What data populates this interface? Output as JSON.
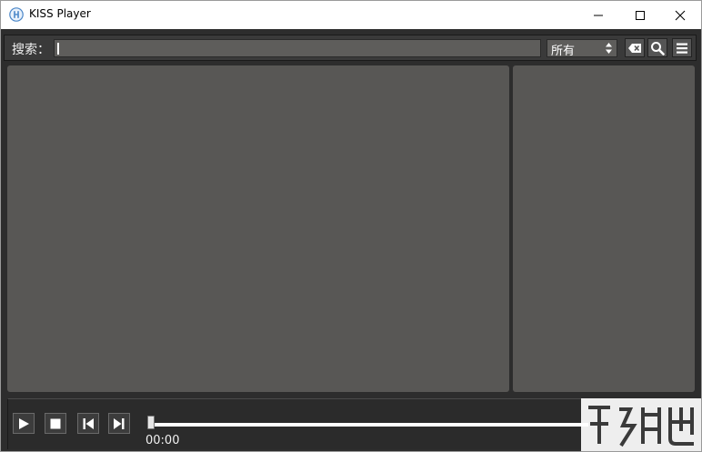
{
  "window": {
    "title": "KISS Player"
  },
  "toolbar": {
    "search_label": "搜索：",
    "search_value": "",
    "filter_selected": "所有"
  },
  "player": {
    "time": "00:00",
    "progress": 0.0
  },
  "colors": {
    "panel": "#585755",
    "frame": "#2d2d2d",
    "input": "#5e5d5b"
  }
}
